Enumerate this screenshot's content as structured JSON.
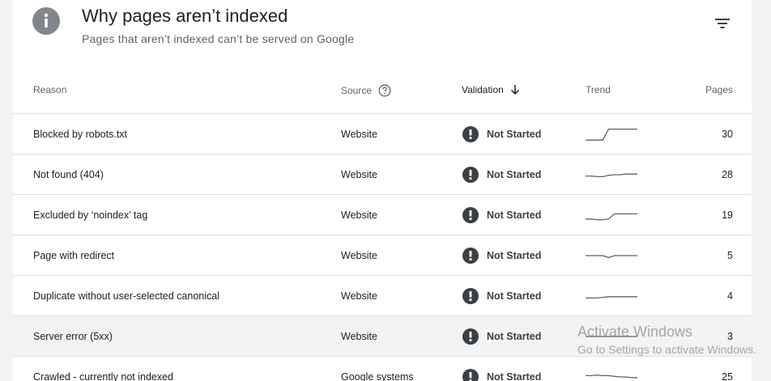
{
  "header": {
    "title": "Why pages aren’t indexed",
    "subtitle": "Pages that aren’t indexed can’t be served on Google"
  },
  "table": {
    "columns": {
      "reason": "Reason",
      "source": "Source",
      "validation": "Validation",
      "trend": "Trend",
      "pages": "Pages"
    },
    "rows": [
      {
        "reason": "Blocked by robots.txt",
        "source": "Website",
        "validation": "Not Started",
        "pages": "30",
        "trend": [
          0.05,
          0.05,
          0.05,
          0.05,
          0.9,
          0.9,
          0.9,
          0.9,
          0.9,
          0.9
        ]
      },
      {
        "reason": "Not found (404)",
        "source": "Website",
        "validation": "Not Started",
        "pages": "28",
        "trend": [
          0.4,
          0.4,
          0.35,
          0.35,
          0.45,
          0.5,
          0.5,
          0.55,
          0.55,
          0.55
        ]
      },
      {
        "reason": "Excluded by ‘noindex’ tag",
        "source": "Website",
        "validation": "Not Started",
        "pages": "19",
        "trend": [
          0.2,
          0.2,
          0.15,
          0.15,
          0.2,
          0.6,
          0.6,
          0.6,
          0.6,
          0.6
        ]
      },
      {
        "reason": "Page with redirect",
        "source": "Website",
        "validation": "Not Started",
        "pages": "5",
        "trend": [
          0.5,
          0.5,
          0.5,
          0.5,
          0.35,
          0.5,
          0.5,
          0.5,
          0.5,
          0.5
        ]
      },
      {
        "reason": "Duplicate without user-selected canonical",
        "source": "Website",
        "validation": "Not Started",
        "pages": "4",
        "trend": [
          0.35,
          0.35,
          0.35,
          0.4,
          0.45,
          0.45,
          0.45,
          0.45,
          0.45,
          0.45
        ]
      },
      {
        "reason": "Server error (5xx)",
        "source": "Website",
        "validation": "Not Started",
        "pages": "3",
        "trend": [
          0.5,
          0.5,
          0.5,
          0.5,
          0.5,
          0.5,
          0.5,
          0.5,
          0.5,
          0.5
        ]
      },
      {
        "reason": "Crawled - currently not indexed",
        "source": "Google systems",
        "validation": "Not Started",
        "pages": "25",
        "trend": [
          0.6,
          0.6,
          0.65,
          0.6,
          0.6,
          0.55,
          0.5,
          0.5,
          0.45,
          0.45
        ]
      }
    ]
  },
  "watermark": {
    "line1": "Activate Windows",
    "line2": "Go to Settings to activate Windows."
  },
  "icons": {
    "info": "info-icon",
    "filter": "filter-icon",
    "help": "help-circle-icon",
    "sort": "arrow-down-icon",
    "status": "exclamation-circle-icon"
  }
}
